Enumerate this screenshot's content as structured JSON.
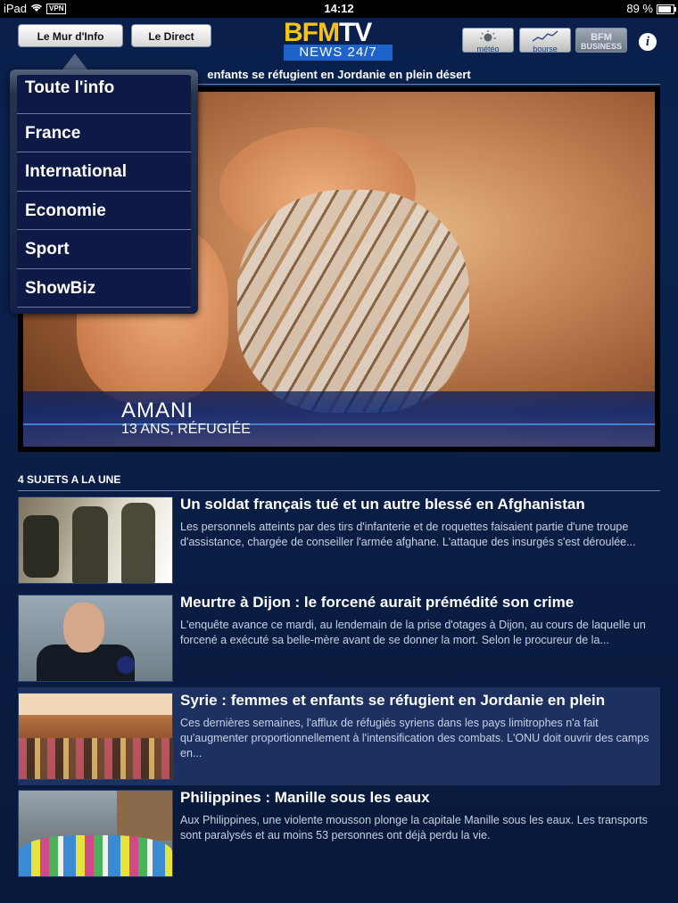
{
  "status_bar": {
    "device": "iPad",
    "vpn": "VPN",
    "time": "14:12",
    "battery": "89 %",
    "battery_level": 0.89
  },
  "header": {
    "btn_mur": "Le Mur d'Info",
    "btn_direct": "Le Direct",
    "logo_top_bfm": "BFM",
    "logo_top_tv": "TV",
    "logo_bottom": "NEWS 24/7",
    "meteo_label": "météo",
    "bourse_label": "bourse",
    "bfm_business_line1": "BFM",
    "bfm_business_line2": "BUSINESS",
    "info_label": "i"
  },
  "headline": "enfants se réfugient en Jordanie en plein désert",
  "hero": {
    "name": "AMANI",
    "subtitle": "13 ANS, RÉFUGIÉE"
  },
  "menu": {
    "items": [
      {
        "label": "Toute l'info"
      },
      {
        "label": "France"
      },
      {
        "label": "International"
      },
      {
        "label": "Economie"
      },
      {
        "label": "Sport"
      },
      {
        "label": "ShowBiz"
      }
    ]
  },
  "section": {
    "title": "4 SUJETS A LA UNE",
    "articles": [
      {
        "title": "Un soldat français tué et un autre blessé en Afghanistan",
        "body": "Les personnels atteints par des tirs d'infanterie et de roquettes faisaient partie d'une troupe d'assistance, chargée de conseiller l'armée afghane. L'attaque des insurgés s'est déroulée..."
      },
      {
        "title": "Meurtre à Dijon : le forcené aurait prémédité son crime",
        "body": "L'enquête avance ce mardi, au  lendemain de la prise d'otages à Dijon, au cours de laquelle un forcené a exécuté sa belle-mère avant de se donner la mort. Selon le procureur de la..."
      },
      {
        "title": "Syrie : femmes et enfants se réfugient en Jordanie en plein",
        "body": "Ces dernières semaines, l'afflux de réfugiés syriens dans les pays limitrophes n'a fait qu'augmenter proportionnellement à l'intensification des combats. L'ONU doit ouvrir des camps en..."
      },
      {
        "title": "Philippines : Manille sous les eaux",
        "body": "Aux Philippines,  une violente mousson plonge la capitale Manille sous les eaux.  Les transports sont paralysés et au moins 53 personnes ont déjà perdu la vie."
      }
    ]
  },
  "colors": {
    "background": "#0a1f4a",
    "logo_yellow": "#f5c21a",
    "logo_blue": "#1d63c9",
    "active_row": "#1c3160"
  }
}
